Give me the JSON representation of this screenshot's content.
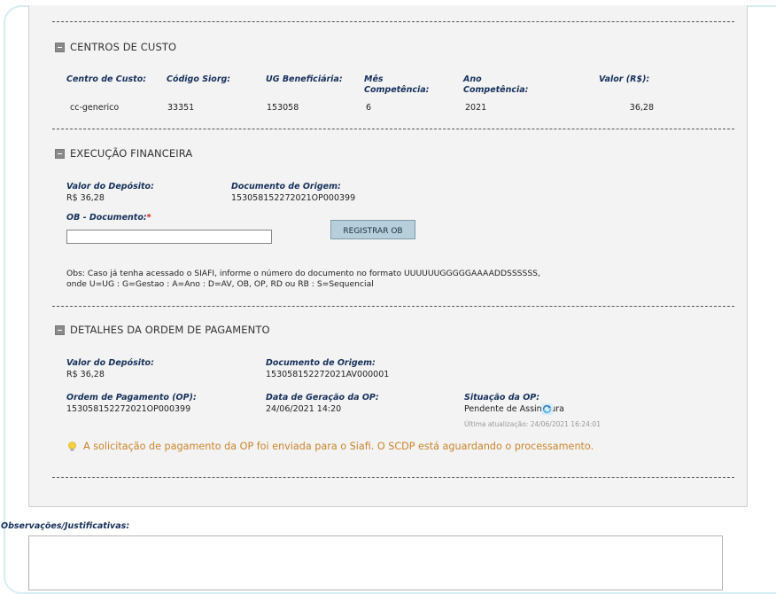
{
  "centros_custo": {
    "title": "CENTROS DE CUSTO",
    "headers": {
      "centro": "Centro de Custo:",
      "siorg": "Código Siorg:",
      "ug": "UG Beneficiária:",
      "mes_l1": "Mês",
      "mes_l2": "Competência:",
      "ano_l1": "Ano",
      "ano_l2": "Competência:",
      "valor": "Valor (R$):"
    },
    "row": {
      "centro": "cc-generico",
      "siorg": "33351",
      "ug": "153058",
      "mes": "6",
      "ano": "2021",
      "valor": "36,28"
    }
  },
  "execucao": {
    "title": "EXECUÇÃO FINANCEIRA",
    "valor_label": "Valor do Depósito:",
    "valor": "R$ 36,28",
    "doc_label": "Documento de Origem:",
    "doc": "153058152272021OP000399",
    "ob_label": "OB - Documento:",
    "required_mark": "*",
    "ob_value": "",
    "button": "REGISTRAR OB",
    "obs_line1": "Obs: Caso já tenha acessado o SIAFI, informe o número do documento no formato UUUUUUGGGGGAAAADDSSSSSS,",
    "obs_line2": "onde U=UG : G=Gestao : A=Ano : D=AV, OB, OP, RD ou RB : S=Sequencial"
  },
  "detalhes": {
    "title": "DETALHES DA ORDEM DE PAGAMENTO",
    "valor_label": "Valor do Depósito:",
    "valor": "R$ 36,28",
    "doc_label": "Documento de Origem:",
    "doc": "153058152272021AV000001",
    "op_label": "Ordem de Pagamento (OP):",
    "op": "153058152272021OP000399",
    "data_label": "Data de Geração da OP:",
    "data": "24/06/2021 14:20",
    "situacao_label": "Situação da OP:",
    "situacao": "Pendente de Assinatura",
    "ultima": "Última atualização: 24/06/2021 16:24:01",
    "notice": "A solicitação de pagamento da OP foi enviada para o Siafi. O SCDP está aguardando o processamento."
  },
  "observacoes": {
    "label": "Observações/Justificativas:",
    "value": ""
  },
  "colors": {
    "label": "#15305a",
    "notice": "#c9852b",
    "button": "#b7cfdb",
    "panel": "#f3f3f3",
    "frame": "#d6eef2"
  },
  "icons": [
    "collapse-icon",
    "lightbulb-icon",
    "refresh-icon"
  ]
}
